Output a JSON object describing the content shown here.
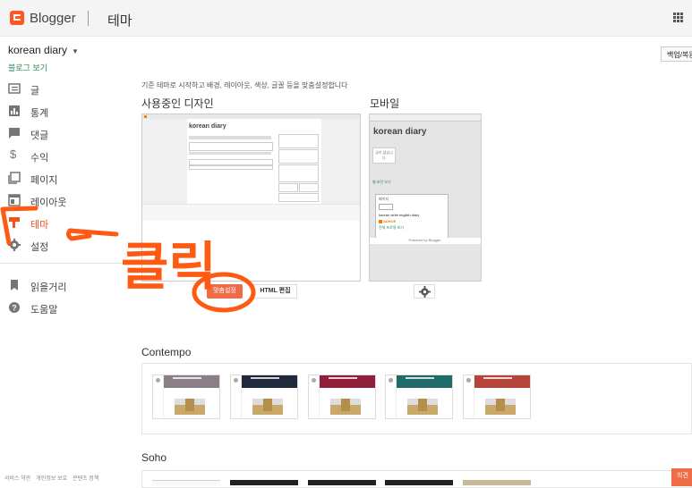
{
  "header": {
    "brand": "Blogger",
    "section": "테마"
  },
  "sidebar": {
    "blog_name": "korean diary",
    "view_blog": "블로그 보기",
    "items": [
      {
        "label": "글",
        "icon": "posts-icon"
      },
      {
        "label": "통계",
        "icon": "stats-icon"
      },
      {
        "label": "댓글",
        "icon": "comments-icon"
      },
      {
        "label": "수익",
        "icon": "earnings-icon"
      },
      {
        "label": "페이지",
        "icon": "pages-icon"
      },
      {
        "label": "레이아웃",
        "icon": "layout-icon"
      },
      {
        "label": "테마",
        "icon": "theme-icon",
        "active": true
      },
      {
        "label": "설정",
        "icon": "settings-icon"
      },
      {
        "label": "읽을거리",
        "icon": "bookmark-icon"
      },
      {
        "label": "도움말",
        "icon": "help-icon"
      }
    ]
  },
  "toolbar": {
    "backup_label": "백업/복원"
  },
  "main": {
    "intro": "기준 테마로 시작하고 배경, 레이아웃, 색상, 글꼴 등을 맞춤설정합니다",
    "current_title": "사용중인 디자인",
    "mobile_title": "모바일",
    "desktop_preview": {
      "blog_title": "korean diary"
    },
    "mobile_preview": {
      "blog_title": "korean diary",
      "no_posts": "글이 없습니다.",
      "view_web": "웹 버전 보기",
      "panel_title": "페이지",
      "panel_line": "korean write english diary",
      "author": "ADHOE",
      "full_profile": "전체 프로필 보기",
      "powered": "Powered by Blogger."
    },
    "customize_label": "맞춤설정",
    "html_edit_label": "HTML 편집",
    "themes": [
      {
        "name": "Contempo",
        "colors": [
          "#8a7f86",
          "#1f2a3a",
          "#8f1f3b",
          "#1f6b68",
          "#b5453b"
        ]
      },
      {
        "name": "Soho"
      }
    ]
  },
  "annotation": {
    "text": "클릭",
    "color": "#ff5a14"
  },
  "footer": {
    "links": [
      "서비스 약관",
      "개인정보 보호",
      "콘텐츠 정책"
    ]
  },
  "feedback_label": "의견"
}
